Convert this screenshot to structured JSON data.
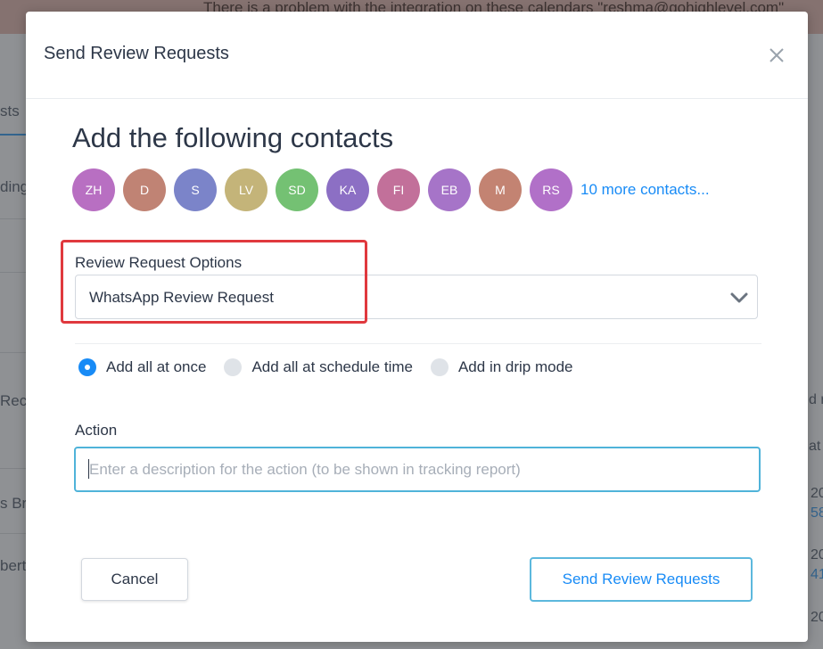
{
  "background": {
    "banner_text": "There is a problem with the integration on these calendars \"reshma@gohighlevel.com\"",
    "left_fragments": [
      "sts",
      "ding",
      "Reco",
      "s Bri",
      "bert"
    ],
    "right_fragments": [
      "d re",
      "at",
      "20",
      "58",
      "20",
      "41",
      "20"
    ]
  },
  "modal": {
    "title": "Send Review Requests",
    "close_icon": "close-icon",
    "contacts_heading": "Add the following contacts",
    "avatars": [
      {
        "initials": "ZH",
        "color": "#b86fc2"
      },
      {
        "initials": "D",
        "color": "#c08374"
      },
      {
        "initials": "S",
        "color": "#7b84c9"
      },
      {
        "initials": "LV",
        "color": "#c4b479"
      },
      {
        "initials": "SD",
        "color": "#74c173"
      },
      {
        "initials": "KA",
        "color": "#8c6fc4"
      },
      {
        "initials": "FI",
        "color": "#c2709a"
      },
      {
        "initials": "EB",
        "color": "#a674c8"
      },
      {
        "initials": "M",
        "color": "#c38372"
      },
      {
        "initials": "RS",
        "color": "#b170c8"
      }
    ],
    "more_contacts": "10 more contacts...",
    "review_options": {
      "label": "Review Request Options",
      "selected": "WhatsApp Review Request"
    },
    "radio_options": [
      {
        "label": "Add all at once",
        "checked": true
      },
      {
        "label": "Add all at schedule time",
        "checked": false
      },
      {
        "label": "Add in drip mode",
        "checked": false
      }
    ],
    "action": {
      "label": "Action",
      "placeholder": "Enter a description for the action (to be shown in tracking report)",
      "value": ""
    },
    "buttons": {
      "cancel": "Cancel",
      "send": "Send Review Requests"
    }
  },
  "colors": {
    "accent": "#188bf6",
    "highlight": "#e0393e",
    "focus_border": "#4fb3d9"
  }
}
